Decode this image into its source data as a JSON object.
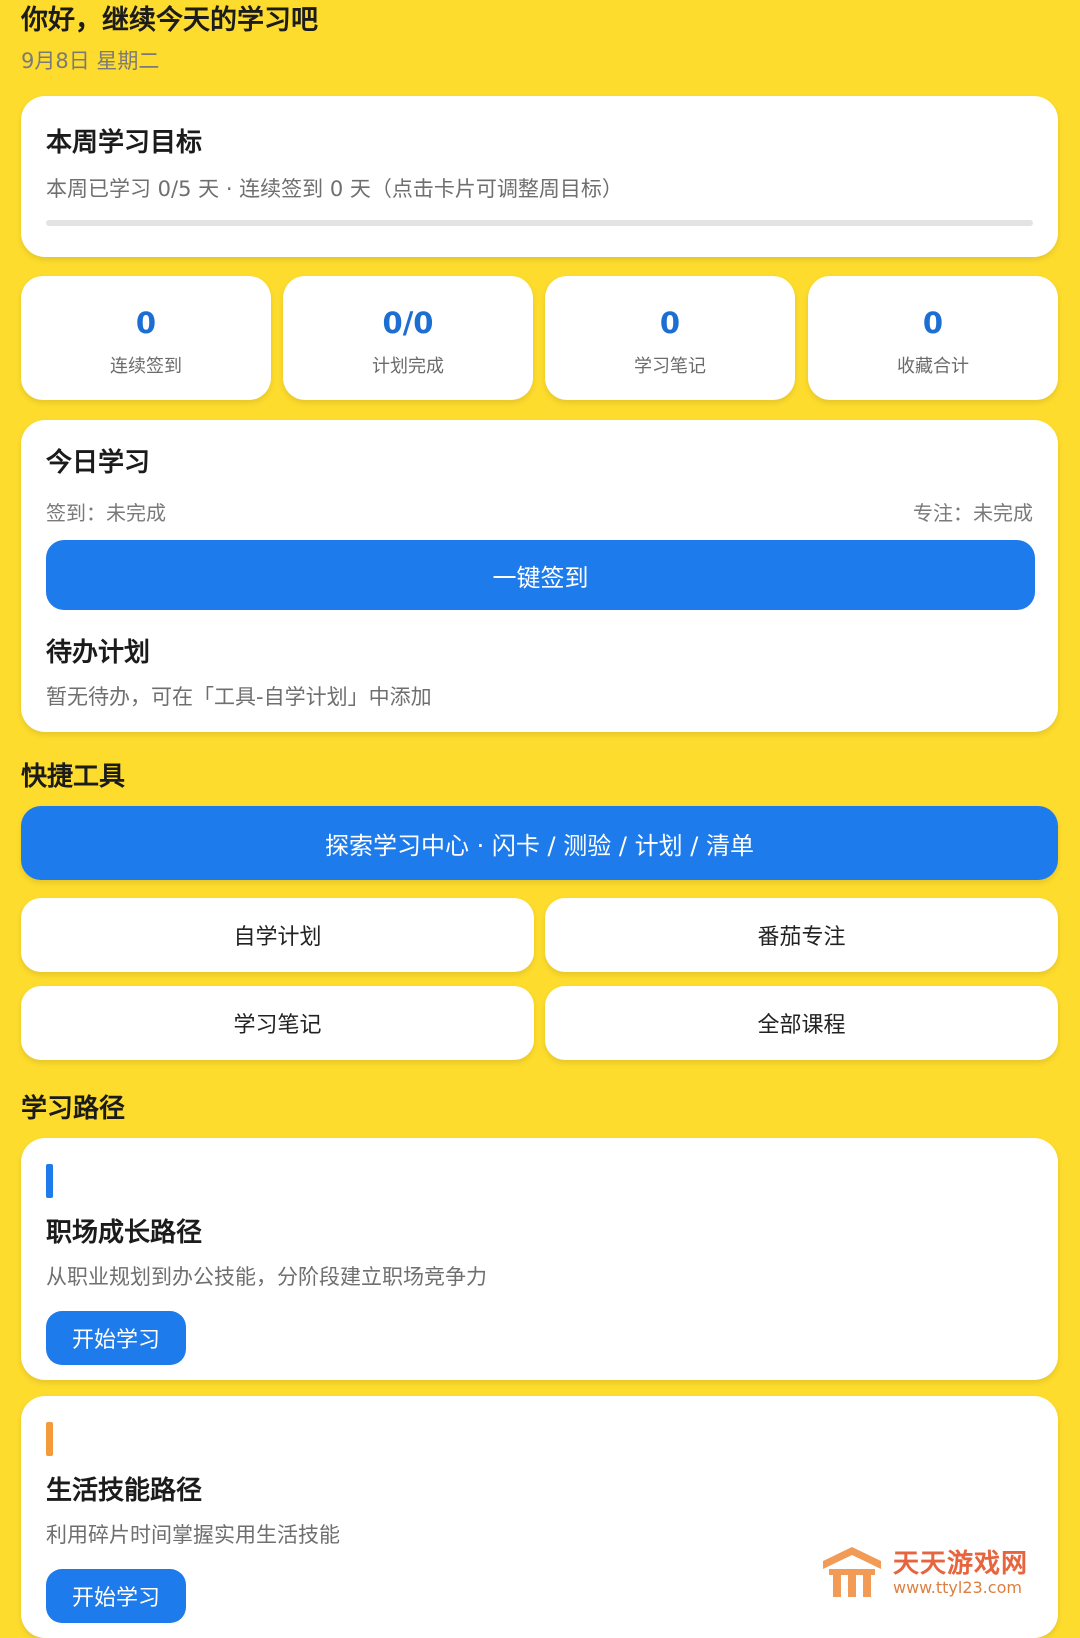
{
  "header": {
    "greeting": "你好，继续今天的学习吧",
    "date": "9月8日 星期二"
  },
  "weekly_goal": {
    "title": "本周学习目标",
    "subtitle": "本周已学习 0/5 天 · 连续签到 0 天（点击卡片可调整周目标）",
    "progress": 0
  },
  "stats": [
    {
      "value": "0",
      "label": "连续签到"
    },
    {
      "value": "0/0",
      "label": "计划完成"
    },
    {
      "value": "0",
      "label": "学习笔记"
    },
    {
      "value": "0",
      "label": "收藏合计"
    }
  ],
  "today": {
    "title": "今日学习",
    "checkin_status": "签到：未完成",
    "focus_status": "专注：未完成",
    "checkin_button": "一键签到",
    "todo_title": "待办计划",
    "todo_empty": "暂无待办，可在「工具-自学计划」中添加"
  },
  "tools": {
    "title": "快捷工具",
    "explore_button": "探索学习中心 · 闪卡 / 测验 / 计划 / 清单",
    "buttons": [
      "自学计划",
      "番茄专注",
      "学习笔记",
      "全部课程"
    ]
  },
  "paths": {
    "title": "学习路径",
    "items": [
      {
        "title": "职场成长路径",
        "desc": "从职业规划到办公技能，分阶段建立职场竞争力",
        "button": "开始学习",
        "accent": "#1E7BEB"
      },
      {
        "title": "生活技能路径",
        "desc": "利用碎片时间掌握实用生活技能",
        "button": "开始学习",
        "accent": "#F39A3A"
      }
    ]
  },
  "watermark": {
    "name": "天天游戏网",
    "url": "www.ttyl23.com"
  },
  "colors": {
    "background": "#FEDC2D",
    "primary": "#1E7BEB",
    "stat_number": "#1C6ED3"
  }
}
